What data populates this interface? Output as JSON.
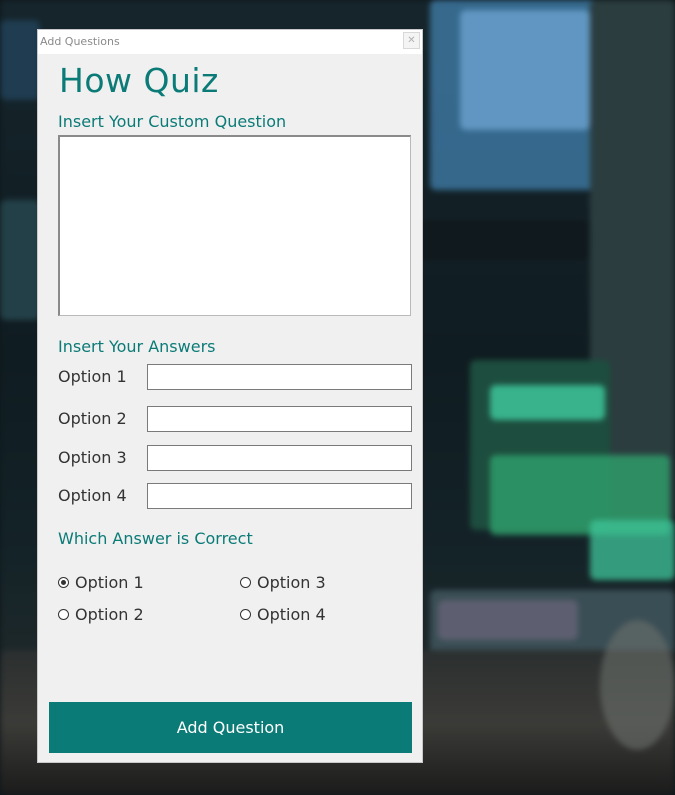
{
  "window": {
    "title": "Add Questions",
    "close_symbol": "✕"
  },
  "app": {
    "title": "How Quiz"
  },
  "question": {
    "label": "Insert Your Custom Question",
    "value": ""
  },
  "answers": {
    "label": "Insert Your Answers",
    "options": [
      {
        "label": "Option 1",
        "value": ""
      },
      {
        "label": "Option 2",
        "value": ""
      },
      {
        "label": "Option 3",
        "value": ""
      },
      {
        "label": "Option 4",
        "value": ""
      }
    ]
  },
  "correct": {
    "label": "Which Answer is Correct",
    "choices": [
      "Option 1",
      "Option 2",
      "Option 3",
      "Option 4"
    ],
    "selected": "Option 1"
  },
  "actions": {
    "add_label": "Add Question"
  },
  "colors": {
    "accent": "#0b7b77",
    "window_bg": "#f0f0f0"
  }
}
